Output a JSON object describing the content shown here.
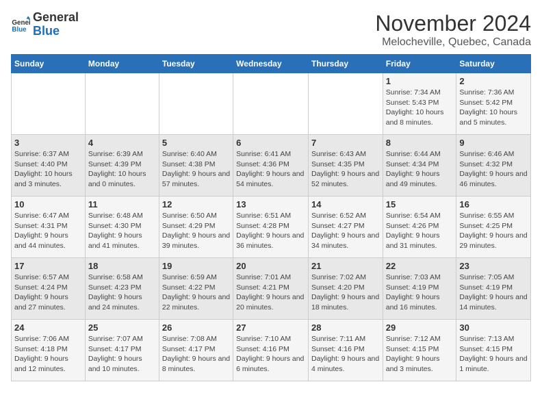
{
  "logo": {
    "text_general": "General",
    "text_blue": "Blue"
  },
  "title": "November 2024",
  "location": "Melocheville, Quebec, Canada",
  "days_of_week": [
    "Sunday",
    "Monday",
    "Tuesday",
    "Wednesday",
    "Thursday",
    "Friday",
    "Saturday"
  ],
  "weeks": [
    [
      {
        "day": "",
        "detail": ""
      },
      {
        "day": "",
        "detail": ""
      },
      {
        "day": "",
        "detail": ""
      },
      {
        "day": "",
        "detail": ""
      },
      {
        "day": "",
        "detail": ""
      },
      {
        "day": "1",
        "detail": "Sunrise: 7:34 AM\nSunset: 5:43 PM\nDaylight: 10 hours and 8 minutes."
      },
      {
        "day": "2",
        "detail": "Sunrise: 7:36 AM\nSunset: 5:42 PM\nDaylight: 10 hours and 5 minutes."
      }
    ],
    [
      {
        "day": "3",
        "detail": "Sunrise: 6:37 AM\nSunset: 4:40 PM\nDaylight: 10 hours and 3 minutes."
      },
      {
        "day": "4",
        "detail": "Sunrise: 6:39 AM\nSunset: 4:39 PM\nDaylight: 10 hours and 0 minutes."
      },
      {
        "day": "5",
        "detail": "Sunrise: 6:40 AM\nSunset: 4:38 PM\nDaylight: 9 hours and 57 minutes."
      },
      {
        "day": "6",
        "detail": "Sunrise: 6:41 AM\nSunset: 4:36 PM\nDaylight: 9 hours and 54 minutes."
      },
      {
        "day": "7",
        "detail": "Sunrise: 6:43 AM\nSunset: 4:35 PM\nDaylight: 9 hours and 52 minutes."
      },
      {
        "day": "8",
        "detail": "Sunrise: 6:44 AM\nSunset: 4:34 PM\nDaylight: 9 hours and 49 minutes."
      },
      {
        "day": "9",
        "detail": "Sunrise: 6:46 AM\nSunset: 4:32 PM\nDaylight: 9 hours and 46 minutes."
      }
    ],
    [
      {
        "day": "10",
        "detail": "Sunrise: 6:47 AM\nSunset: 4:31 PM\nDaylight: 9 hours and 44 minutes."
      },
      {
        "day": "11",
        "detail": "Sunrise: 6:48 AM\nSunset: 4:30 PM\nDaylight: 9 hours and 41 minutes."
      },
      {
        "day": "12",
        "detail": "Sunrise: 6:50 AM\nSunset: 4:29 PM\nDaylight: 9 hours and 39 minutes."
      },
      {
        "day": "13",
        "detail": "Sunrise: 6:51 AM\nSunset: 4:28 PM\nDaylight: 9 hours and 36 minutes."
      },
      {
        "day": "14",
        "detail": "Sunrise: 6:52 AM\nSunset: 4:27 PM\nDaylight: 9 hours and 34 minutes."
      },
      {
        "day": "15",
        "detail": "Sunrise: 6:54 AM\nSunset: 4:26 PM\nDaylight: 9 hours and 31 minutes."
      },
      {
        "day": "16",
        "detail": "Sunrise: 6:55 AM\nSunset: 4:25 PM\nDaylight: 9 hours and 29 minutes."
      }
    ],
    [
      {
        "day": "17",
        "detail": "Sunrise: 6:57 AM\nSunset: 4:24 PM\nDaylight: 9 hours and 27 minutes."
      },
      {
        "day": "18",
        "detail": "Sunrise: 6:58 AM\nSunset: 4:23 PM\nDaylight: 9 hours and 24 minutes."
      },
      {
        "day": "19",
        "detail": "Sunrise: 6:59 AM\nSunset: 4:22 PM\nDaylight: 9 hours and 22 minutes."
      },
      {
        "day": "20",
        "detail": "Sunrise: 7:01 AM\nSunset: 4:21 PM\nDaylight: 9 hours and 20 minutes."
      },
      {
        "day": "21",
        "detail": "Sunrise: 7:02 AM\nSunset: 4:20 PM\nDaylight: 9 hours and 18 minutes."
      },
      {
        "day": "22",
        "detail": "Sunrise: 7:03 AM\nSunset: 4:19 PM\nDaylight: 9 hours and 16 minutes."
      },
      {
        "day": "23",
        "detail": "Sunrise: 7:05 AM\nSunset: 4:19 PM\nDaylight: 9 hours and 14 minutes."
      }
    ],
    [
      {
        "day": "24",
        "detail": "Sunrise: 7:06 AM\nSunset: 4:18 PM\nDaylight: 9 hours and 12 minutes."
      },
      {
        "day": "25",
        "detail": "Sunrise: 7:07 AM\nSunset: 4:17 PM\nDaylight: 9 hours and 10 minutes."
      },
      {
        "day": "26",
        "detail": "Sunrise: 7:08 AM\nSunset: 4:17 PM\nDaylight: 9 hours and 8 minutes."
      },
      {
        "day": "27",
        "detail": "Sunrise: 7:10 AM\nSunset: 4:16 PM\nDaylight: 9 hours and 6 minutes."
      },
      {
        "day": "28",
        "detail": "Sunrise: 7:11 AM\nSunset: 4:16 PM\nDaylight: 9 hours and 4 minutes."
      },
      {
        "day": "29",
        "detail": "Sunrise: 7:12 AM\nSunset: 4:15 PM\nDaylight: 9 hours and 3 minutes."
      },
      {
        "day": "30",
        "detail": "Sunrise: 7:13 AM\nSunset: 4:15 PM\nDaylight: 9 hours and 1 minute."
      }
    ]
  ]
}
